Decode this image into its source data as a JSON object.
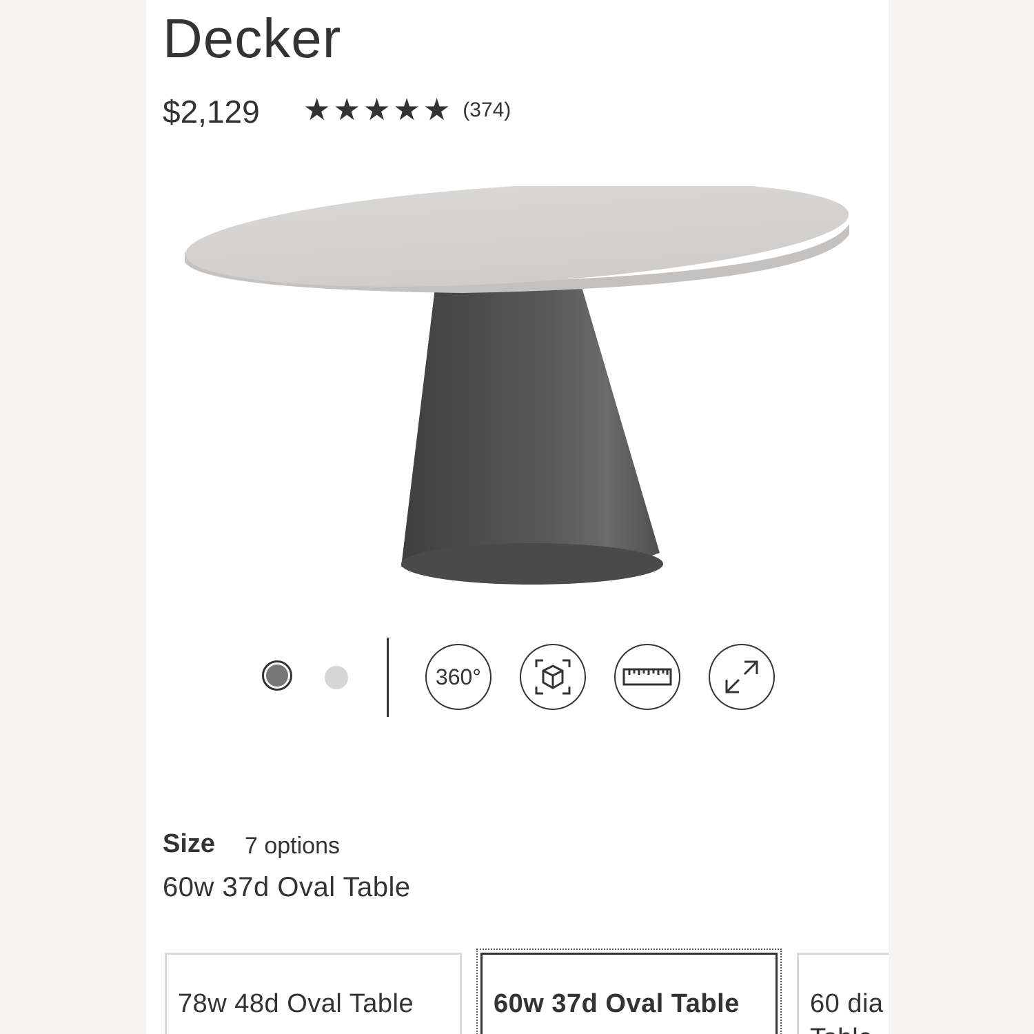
{
  "product": {
    "name": "Decker",
    "price": "$2,129",
    "rating_stars": 5,
    "review_count": "(374)"
  },
  "colors": {
    "tabletop": "#d6d3d0",
    "base": "#4b4b4b",
    "text": "#333333",
    "background": "#f7f4f1"
  },
  "gallery": {
    "dots": [
      "selected",
      "unselected"
    ],
    "buttons": [
      {
        "label": "360°",
        "icon": "360-icon"
      },
      {
        "label": "",
        "icon": "ar-cube-icon"
      },
      {
        "label": "",
        "icon": "ruler-icon"
      },
      {
        "label": "",
        "icon": "expand-icon"
      }
    ]
  },
  "size": {
    "label": "Size",
    "options_count": "7 options",
    "selected": "60w 37d Oval Table",
    "tiles": [
      {
        "label": "78w 48d Oval Table",
        "selected": false
      },
      {
        "label": "60w 37d Oval Table",
        "selected": true
      },
      {
        "label": "60 dia",
        "label_line2": "Table",
        "selected": false
      }
    ]
  }
}
